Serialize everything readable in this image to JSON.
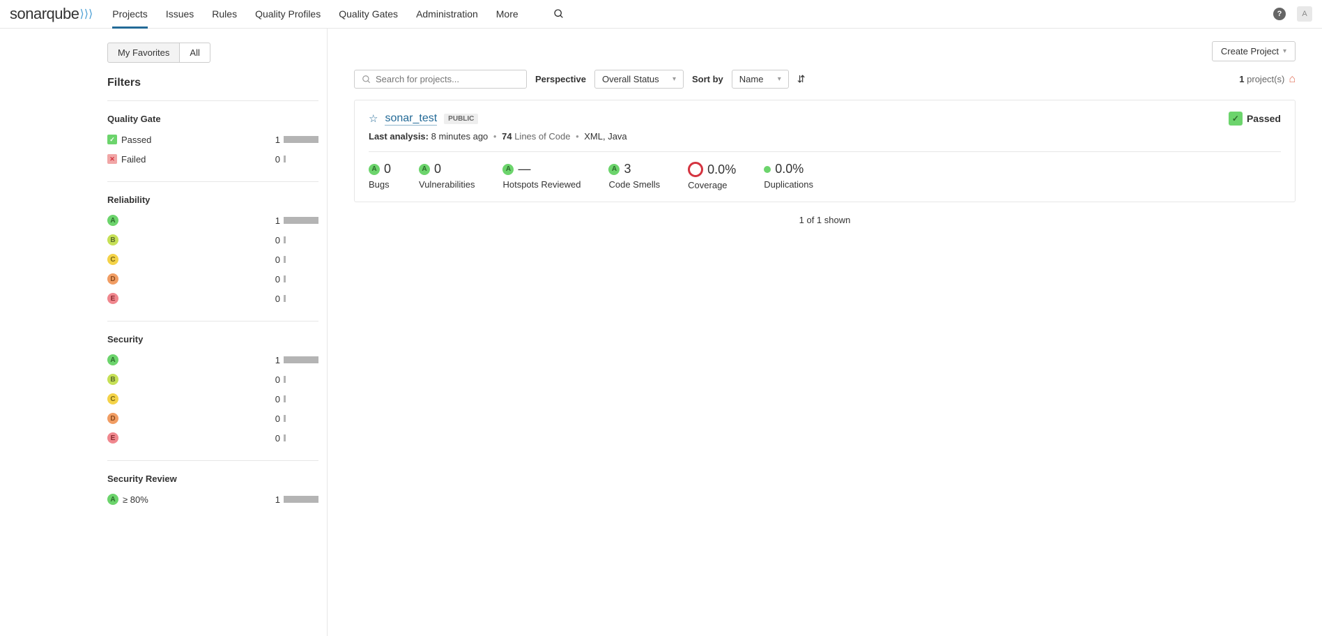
{
  "nav": {
    "items": [
      "Projects",
      "Issues",
      "Rules",
      "Quality Profiles",
      "Quality Gates",
      "Administration",
      "More"
    ],
    "activeIndex": 0
  },
  "avatar_letter": "A",
  "sidebar": {
    "tabs": [
      "My Favorites",
      "All"
    ],
    "activeTab": 0,
    "filters_title": "Filters",
    "sections": {
      "quality_gate": {
        "title": "Quality Gate",
        "passed_label": "Passed",
        "passed_count": "1",
        "failed_label": "Failed",
        "failed_count": "0"
      },
      "reliability": {
        "title": "Reliability",
        "rows": [
          {
            "rating": "A",
            "count": "1",
            "full": true
          },
          {
            "rating": "B",
            "count": "0",
            "full": false
          },
          {
            "rating": "C",
            "count": "0",
            "full": false
          },
          {
            "rating": "D",
            "count": "0",
            "full": false
          },
          {
            "rating": "E",
            "count": "0",
            "full": false
          }
        ]
      },
      "security": {
        "title": "Security",
        "rows": [
          {
            "rating": "A",
            "count": "1",
            "full": true
          },
          {
            "rating": "B",
            "count": "0",
            "full": false
          },
          {
            "rating": "C",
            "count": "0",
            "full": false
          },
          {
            "rating": "D",
            "count": "0",
            "full": false
          },
          {
            "rating": "E",
            "count": "0",
            "full": false
          }
        ]
      },
      "security_review": {
        "title": "Security Review",
        "rows": [
          {
            "rating": "A",
            "label": "≥ 80%",
            "count": "1",
            "full": true
          }
        ]
      }
    }
  },
  "toolbar": {
    "create_project_label": "Create Project",
    "search_placeholder": "Search for projects...",
    "perspective_label": "Perspective",
    "perspective_value": "Overall Status",
    "sort_label": "Sort by",
    "sort_value": "Name",
    "project_count_num": "1",
    "project_count_label": "project(s)"
  },
  "project": {
    "name": "sonar_test",
    "visibility": "PUBLIC",
    "qg_status": "Passed",
    "last_analysis_label": "Last analysis:",
    "last_analysis_value": "8 minutes ago",
    "loc_value": "74",
    "loc_label": "Lines of Code",
    "languages": "XML, Java",
    "metrics": {
      "bugs": {
        "rating": "A",
        "value": "0",
        "label": "Bugs"
      },
      "vulnerabilities": {
        "rating": "A",
        "value": "0",
        "label": "Vulnerabilities"
      },
      "hotspots": {
        "rating": "A",
        "value": "—",
        "label": "Hotspots Reviewed"
      },
      "code_smells": {
        "rating": "A",
        "value": "3",
        "label": "Code Smells"
      },
      "coverage": {
        "value": "0.0%",
        "label": "Coverage"
      },
      "duplications": {
        "value": "0.0%",
        "label": "Duplications"
      }
    }
  },
  "shown_text": "1 of 1 shown"
}
